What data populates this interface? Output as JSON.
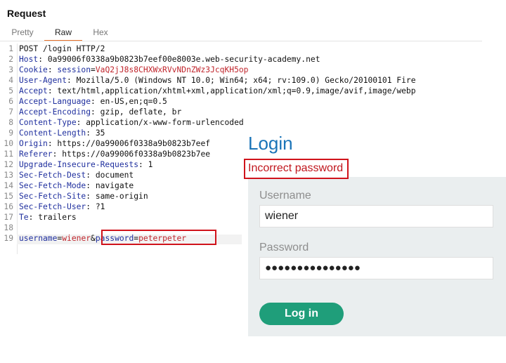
{
  "panel_title": "Request",
  "tabs": [
    "Pretty",
    "Raw",
    "Hex"
  ],
  "active_tab": "Raw",
  "accent_color": "#e8702a",
  "request_lines": [
    {
      "n": "1",
      "key": "",
      "sep": "",
      "val": "POST /login HTTP/2"
    },
    {
      "n": "2",
      "key": "Host",
      "sep": ": ",
      "val": "0a99006f0338a9b0823b7eef00e8003e.web-security-academy.net"
    },
    {
      "n": "3",
      "key": "Cookie",
      "sep": ": ",
      "cookie_key": "session",
      "cookie_val": "VaQ2jJ8s8CHXWxRVvNDnZWz3JcqKH5op"
    },
    {
      "n": "4",
      "key": "User-Agent",
      "sep": ": ",
      "val": "Mozilla/5.0 (Windows NT 10.0; Win64; x64; rv:109.0) Gecko/20100101 Fire"
    },
    {
      "n": "5",
      "key": "Accept",
      "sep": ": ",
      "val": "text/html,application/xhtml+xml,application/xml;q=0.9,image/avif,image/webp"
    },
    {
      "n": "6",
      "key": "Accept-Language",
      "sep": ": ",
      "val": "en-US,en;q=0.5"
    },
    {
      "n": "7",
      "key": "Accept-Encoding",
      "sep": ": ",
      "val": "gzip, deflate, br"
    },
    {
      "n": "8",
      "key": "Content-Type",
      "sep": ": ",
      "val": "application/x-www-form-urlencoded"
    },
    {
      "n": "9",
      "key": "Content-Length",
      "sep": ": ",
      "val": "35"
    },
    {
      "n": "10",
      "key": "Origin",
      "sep": ": ",
      "val": "https://0a99006f0338a9b0823b7eef"
    },
    {
      "n": "11",
      "key": "Referer",
      "sep": ": ",
      "val": "https://0a99006f0338a9b0823b7ee"
    },
    {
      "n": "12",
      "key": "Upgrade-Insecure-Requests",
      "sep": ": ",
      "val": "1"
    },
    {
      "n": "13",
      "key": "Sec-Fetch-Dest",
      "sep": ": ",
      "val": "document"
    },
    {
      "n": "14",
      "key": "Sec-Fetch-Mode",
      "sep": ": ",
      "val": "navigate"
    },
    {
      "n": "15",
      "key": "Sec-Fetch-Site",
      "sep": ": ",
      "val": "same-origin"
    },
    {
      "n": "16",
      "key": "Sec-Fetch-User",
      "sep": ": ",
      "val": "?1"
    },
    {
      "n": "17",
      "key": "Te",
      "sep": ": ",
      "val": "trailers"
    },
    {
      "n": "18",
      "key": "",
      "sep": "",
      "val": ""
    },
    {
      "n": "19",
      "body": true,
      "p1k": "username",
      "p1v": "wiener",
      "p2k": "password",
      "p2v": "peterpeter"
    }
  ],
  "login": {
    "title": "Login",
    "error": "Incorrect password",
    "username_label": "Username",
    "username_value": "wiener",
    "password_label": "Password",
    "password_value": "●●●●●●●●●●●●●●●",
    "button_label": "Log in"
  }
}
